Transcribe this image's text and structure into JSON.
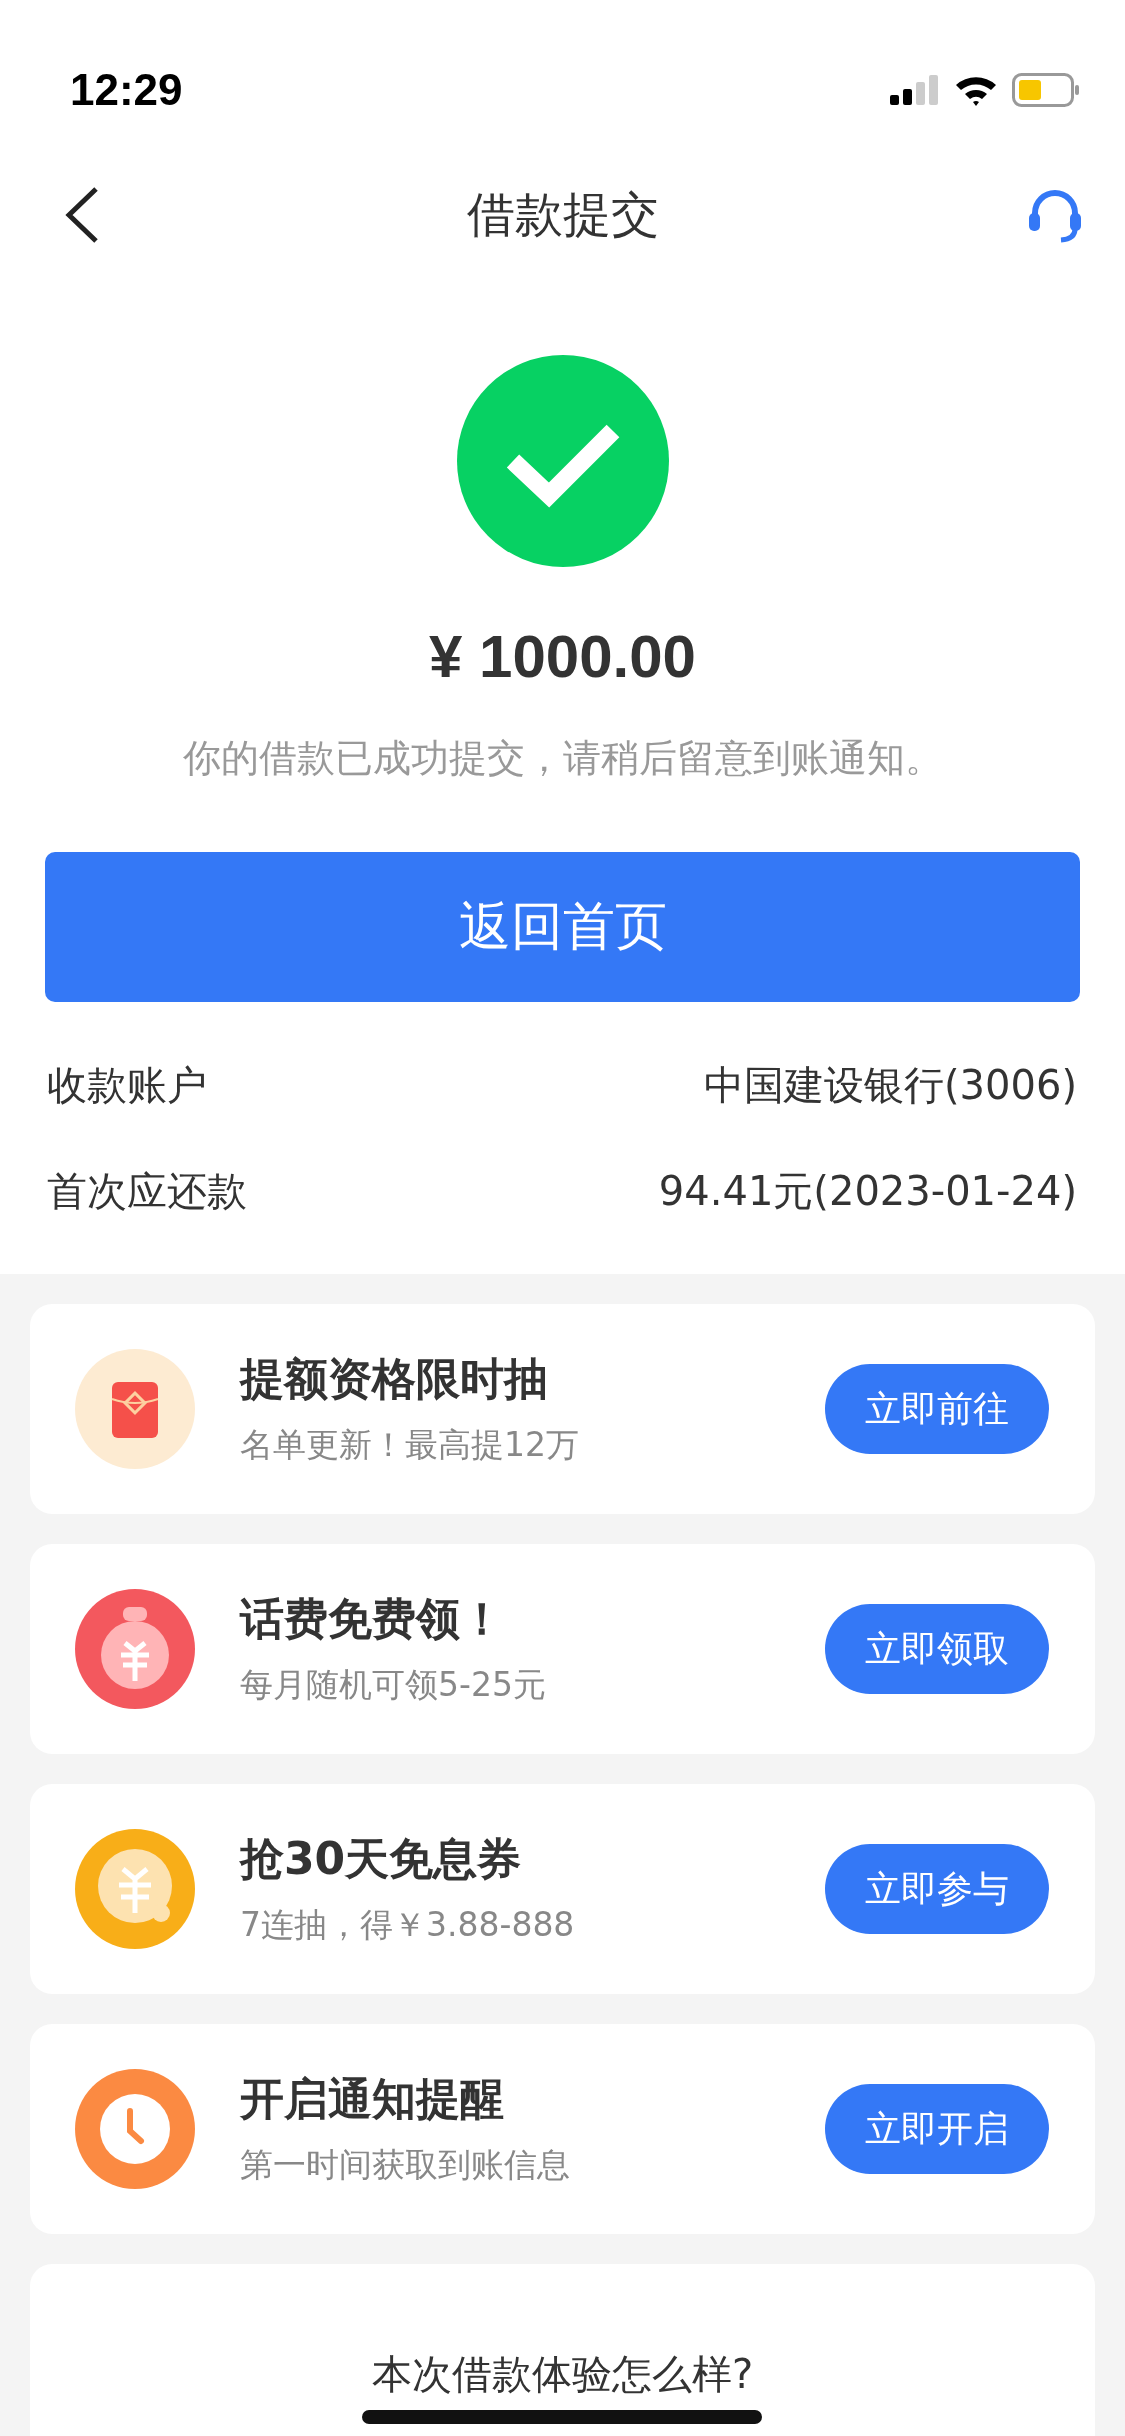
{
  "status_bar": {
    "time": "12:29"
  },
  "nav": {
    "title": "借款提交"
  },
  "result": {
    "amount": "¥ 1000.00",
    "message": "你的借款已成功提交，请稍后留意到账通知。",
    "button": "返回首页"
  },
  "details": [
    {
      "label": "收款账户",
      "value": "中国建设银行(3006)"
    },
    {
      "label": "首次应还款",
      "value": "94.41元(2023-01-24)"
    }
  ],
  "promos": [
    {
      "kind": "envelope",
      "title": "提额资格限时抽",
      "subtitle": "名单更新！最高提12万",
      "button": "立即前往"
    },
    {
      "kind": "moneybag",
      "title": "话费免费领！",
      "subtitle": "每月随机可领5-25元",
      "button": "立即领取"
    },
    {
      "kind": "coin",
      "title": "抢30天免息券",
      "subtitle": "7连抽，得￥3.88-888",
      "button": "立即参与"
    },
    {
      "kind": "clock",
      "title": "开启通知提醒",
      "subtitle": "第一时间获取到账信息",
      "button": "立即开启"
    }
  ],
  "survey": {
    "title": "本次借款体验怎么样?"
  }
}
